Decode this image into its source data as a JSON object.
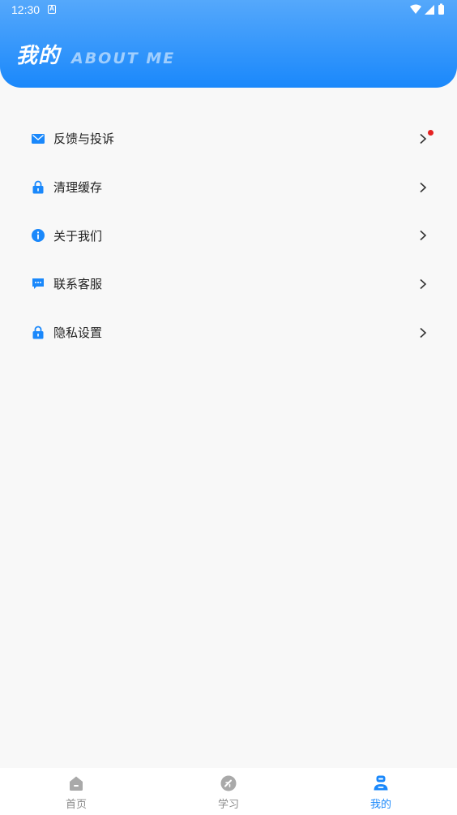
{
  "status_bar": {
    "time": "12:30",
    "app_icon_letter": "A"
  },
  "header": {
    "title": "我的",
    "subtitle": "ABOUT ME"
  },
  "menu": {
    "items": [
      {
        "label": "反馈与投诉",
        "icon": "mail-icon",
        "has_badge": true
      },
      {
        "label": "清理缓存",
        "icon": "lock-icon",
        "has_badge": false
      },
      {
        "label": "关于我们",
        "icon": "info-icon",
        "has_badge": false
      },
      {
        "label": "联系客服",
        "icon": "chat-icon",
        "has_badge": false
      },
      {
        "label": "隐私设置",
        "icon": "lock-icon",
        "has_badge": false
      }
    ]
  },
  "tabbar": {
    "tabs": [
      {
        "label": "首页",
        "icon": "home-icon",
        "active": false
      },
      {
        "label": "学习",
        "icon": "study-icon",
        "active": false
      },
      {
        "label": "我的",
        "icon": "profile-icon",
        "active": true
      }
    ]
  },
  "colors": {
    "accent": "#1a88fb",
    "header_gradient_top": "#55a8fb",
    "badge": "#e52222",
    "inactive_tab": "#8a8a8a"
  }
}
